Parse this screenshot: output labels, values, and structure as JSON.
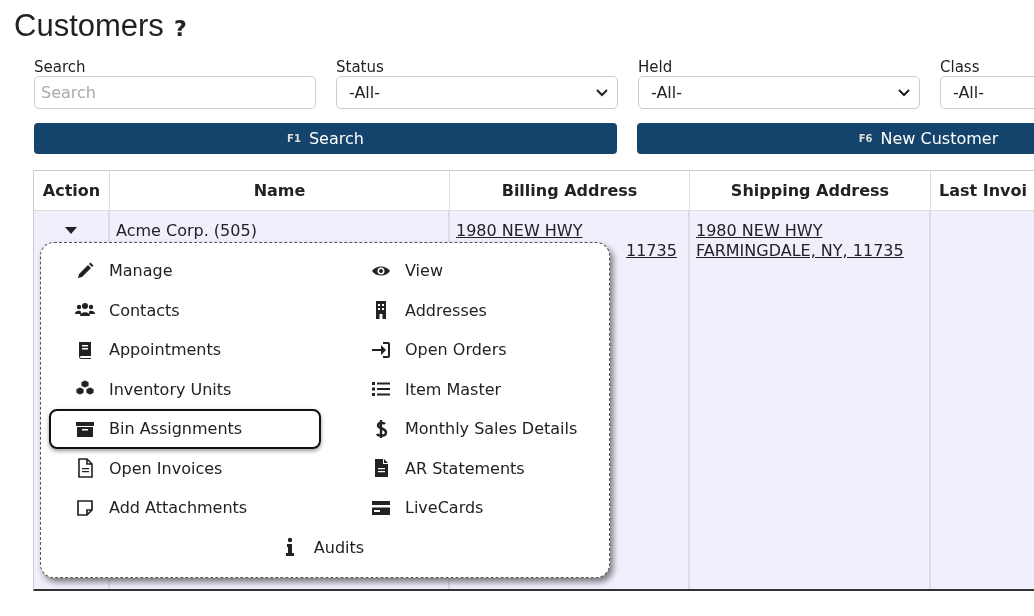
{
  "page": {
    "title": "Customers",
    "help": "?"
  },
  "filters": [
    {
      "label": "Search",
      "kind": "text",
      "placeholder": "Search"
    },
    {
      "label": "Status",
      "kind": "select",
      "value": "-All-"
    },
    {
      "label": "Held",
      "kind": "select",
      "value": "-All-"
    },
    {
      "label": "Class",
      "kind": "select",
      "value": "-All-"
    }
  ],
  "buttons": [
    {
      "key": "F1",
      "label": "Search"
    },
    {
      "key": "F6",
      "label": "New Customer"
    }
  ],
  "table": {
    "columns": [
      "Action",
      "Name",
      "Billing Address",
      "Shipping Address",
      "Last Invoi"
    ],
    "rows": [
      {
        "name": "Acme Corp. (505)",
        "billing": [
          "1980 NEW HWY"
        ],
        "billing_visible_end": "11735",
        "shipping": [
          "1980 NEW HWY",
          "FARMINGDALE, NY, 11735"
        ],
        "expanded": true
      }
    ]
  },
  "action_menu": {
    "items": [
      {
        "label": "Manage",
        "selected": false
      },
      {
        "label": "View",
        "selected": false
      },
      {
        "label": "Contacts",
        "selected": false
      },
      {
        "label": "Addresses",
        "selected": false
      },
      {
        "label": "Appointments",
        "selected": false
      },
      {
        "label": "Open Orders",
        "selected": false
      },
      {
        "label": "Inventory Units",
        "selected": false
      },
      {
        "label": "Item Master",
        "selected": false
      },
      {
        "label": "Bin Assignments",
        "selected": true
      },
      {
        "label": "Monthly Sales Details",
        "selected": false
      },
      {
        "label": "Open Invoices",
        "selected": false
      },
      {
        "label": "AR Statements",
        "selected": false
      },
      {
        "label": "Add Attachments",
        "selected": false
      },
      {
        "label": "LiveCards",
        "selected": false
      },
      {
        "label": "Audits",
        "selected": false
      }
    ]
  }
}
